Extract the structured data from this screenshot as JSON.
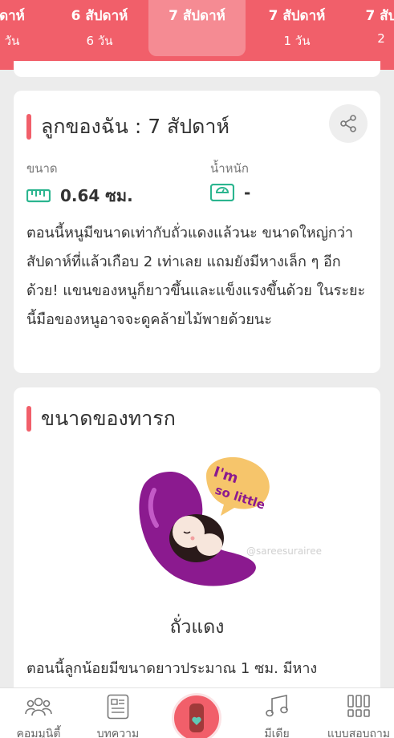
{
  "week_tabs": [
    {
      "week": "ดาห์",
      "day": "วัน"
    },
    {
      "week": "6 สัปดาห์",
      "day": "6 วัน"
    },
    {
      "week": "7 สัปดาห์",
      "day": ""
    },
    {
      "week": "7 สัปดาห์",
      "day": "1 วัน"
    },
    {
      "week": "7 สัป",
      "day": "2"
    }
  ],
  "baby_card": {
    "title": "ลูกของฉัน :  7 สัปดาห์",
    "size_label": "ขนาด",
    "size_value": "0.64 ซม.",
    "weight_label": "น้ำหนัก",
    "weight_value": "-",
    "description": "ตอนนี้หนูมีขนาดเท่ากับถั่วแดงแล้วนะ ขนาดใหญ่กว่าสัปดาห์ที่แล้วเกือบ 2 เท่าเลย แถมยังมีหางเล็ก ๆ อีกด้วย! แขนของหนูก็ยาวขึ้นและแข็งแรงขึ้นด้วย ในระยะนี้มือของหนูอาจจะดูคล้ายไม้พายด้วยนะ"
  },
  "size_card": {
    "title": "ขนาดของทารก",
    "bubble_text_1": "I'm",
    "bubble_text_2": "so little",
    "watermark": "@sareesurairee",
    "food_name": "ถั่วแดง",
    "description": "ตอนนี้ลูกน้อยมีขนาดยาวประมาณ 1 ซม. มีหาง"
  },
  "bottom_nav": {
    "community": "คอมมูนิตี้",
    "articles": "บทความ",
    "media": "มีเดีย",
    "quiz": "แบบสอบถาม"
  },
  "colors": {
    "accent": "#f15f6a",
    "ruler_icon": "#2bb58f",
    "bean": "#8b1a8f"
  }
}
